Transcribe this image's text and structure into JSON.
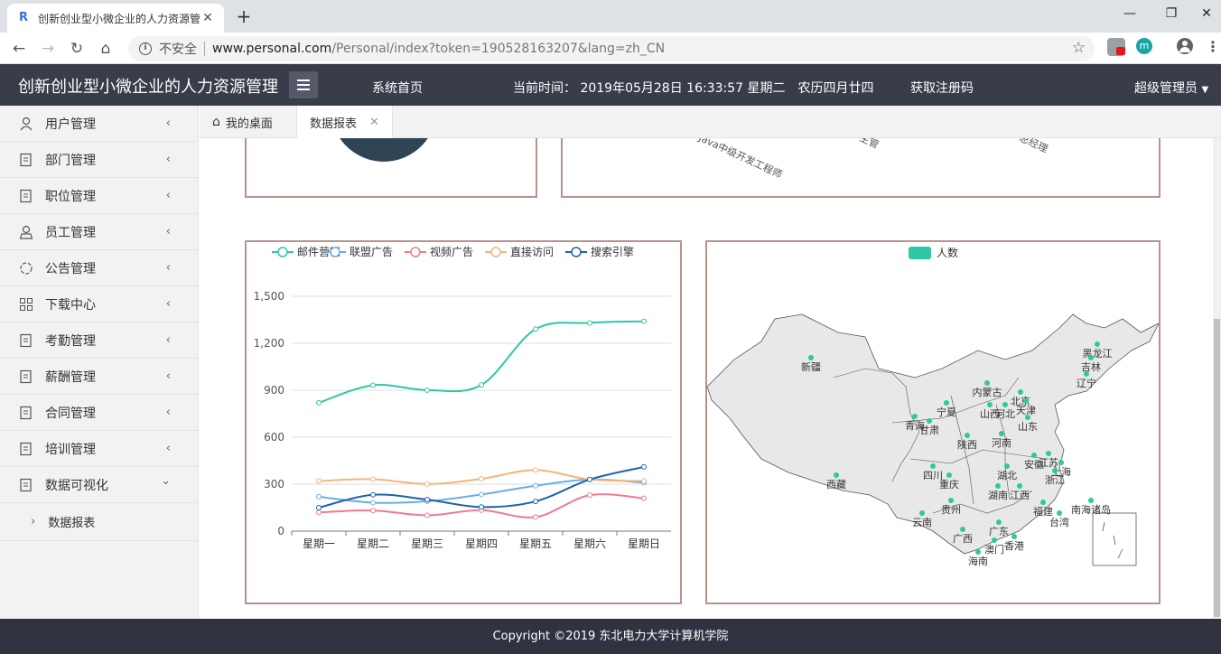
{
  "browser": {
    "tab_title": "创新创业型小微企业的人力资源管",
    "new_tab": "+",
    "insecure_label": "不安全",
    "url_host": "www.personal.com",
    "url_path": "/Personal/index?token=190528163207&lang=zh_CN",
    "ext_m_label": "m"
  },
  "header": {
    "title": "创新创业型小微企业的人力资源管理",
    "home": "系统首页",
    "time": "当前时间： 2019年05月28日 16:33:57 星期二　农历四月廿四",
    "register": "获取注册码",
    "user": "超级管理员"
  },
  "sidebar": {
    "items": [
      {
        "label": "用户管理",
        "icon": "user-icon"
      },
      {
        "label": "部门管理",
        "icon": "document-icon"
      },
      {
        "label": "职位管理",
        "icon": "document-icon"
      },
      {
        "label": "员工管理",
        "icon": "employee-icon"
      },
      {
        "label": "公告管理",
        "icon": "announcement-icon"
      },
      {
        "label": "下载中心",
        "icon": "grid-icon"
      },
      {
        "label": "考勤管理",
        "icon": "document-icon"
      },
      {
        "label": "薪酬管理",
        "icon": "document-icon"
      },
      {
        "label": "合同管理",
        "icon": "document-icon"
      },
      {
        "label": "培训管理",
        "icon": "document-icon"
      },
      {
        "label": "数据可视化",
        "icon": "document-icon"
      }
    ],
    "subitem": "数据报表"
  },
  "tabs": {
    "desk": "我的桌面",
    "report": "数据报表"
  },
  "top_chart_labels": [
    "Java中级开发工程师",
    "主管",
    "总经理"
  ],
  "chart_data": [
    {
      "type": "line",
      "categories": [
        "星期一",
        "星期二",
        "星期三",
        "星期四",
        "星期五",
        "星期六",
        "星期日"
      ],
      "series": [
        {
          "name": "邮件营销",
          "color": "#2ec7a5",
          "values": [
            820,
            932,
            901,
            934,
            1290,
            1330,
            1340
          ]
        },
        {
          "name": "联盟广告",
          "color": "#6aaee8",
          "values": [
            220,
            182,
            191,
            234,
            290,
            330,
            310
          ]
        },
        {
          "name": "视频广告",
          "color": "#f07b8d",
          "values": [
            120,
            132,
            101,
            134,
            90,
            230,
            210
          ]
        },
        {
          "name": "直接访问",
          "color": "#f5b47c",
          "values": [
            320,
            332,
            301,
            334,
            390,
            330,
            320
          ]
        },
        {
          "name": "搜索引擎",
          "color": "#1e63a8",
          "values": [
            150,
            232,
            201,
            154,
            190,
            330,
            410
          ]
        }
      ],
      "yticks": [
        "0",
        "300",
        "600",
        "900",
        "1,200",
        "1,500"
      ],
      "ylim": [
        0,
        1500
      ]
    },
    {
      "type": "map",
      "legend": "人数",
      "legend_color": "#2ec7a5",
      "regions": [
        "新疆",
        "西藏",
        "青海",
        "甘肃",
        "宁夏",
        "内蒙古",
        "黑龙江",
        "吉林",
        "辽宁",
        "北京",
        "天津",
        "河北",
        "山西",
        "山东",
        "陕西",
        "河南",
        "四川",
        "重庆",
        "湖北",
        "安徽",
        "江苏",
        "上海",
        "浙江",
        "湖南",
        "江西",
        "贵州",
        "云南",
        "广西",
        "广东",
        "福建",
        "台湾",
        "海南",
        "香港",
        "澳门",
        "南海诸岛"
      ]
    }
  ],
  "footer": "Copyright ©2019 东北电力大学计算机学院"
}
